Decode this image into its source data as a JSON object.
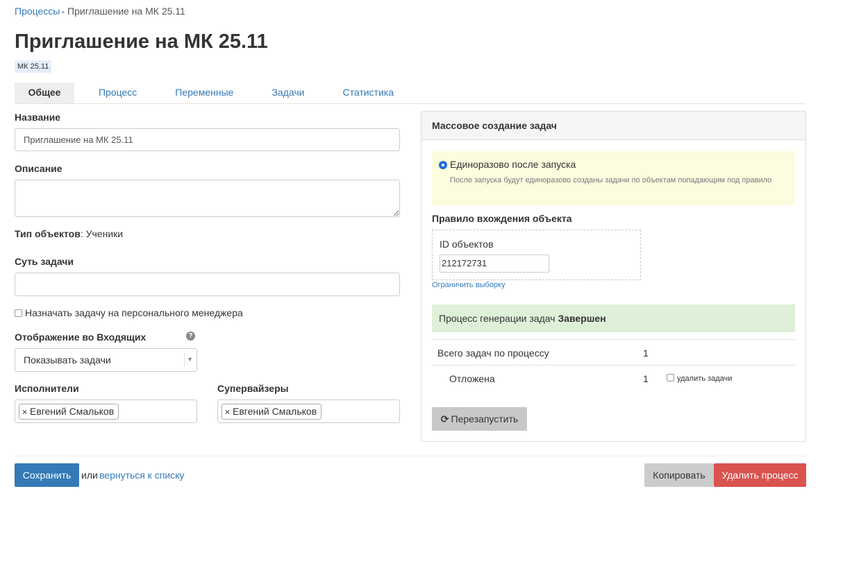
{
  "breadcrumb": {
    "root": "Процессы",
    "separator": "-",
    "current": "Приглашение на МК 25.11"
  },
  "page": {
    "title": "Приглашение на МК 25.11",
    "badge": "МК 25.11"
  },
  "tabs": [
    {
      "label": "Общее",
      "active": true
    },
    {
      "label": "Процесс"
    },
    {
      "label": "Переменные"
    },
    {
      "label": "Задачи"
    },
    {
      "label": "Статистика"
    }
  ],
  "form": {
    "name_label": "Название",
    "name_value": "Приглашение на МК 25.11",
    "description_label": "Описание",
    "description_value": "",
    "object_type_label": "Тип объектов",
    "object_type_value": ": Ученики",
    "task_essence_label": "Суть задачи",
    "task_essence_value": "",
    "assign_manager_label": "Назначать задачу на персонального менеджера",
    "inbox_display_label": "Отображение во Входящих",
    "inbox_display_value": "Показывать задачи",
    "help_icon": "?",
    "executors_label": "Исполнители",
    "executor": "Евгений Смальков",
    "supervisors_label": "Супервайзеры",
    "supervisor": "Евгений Смальков",
    "chip_remove": "×"
  },
  "panel": {
    "title": "Массовое создание задач",
    "radio_label": "Единоразово после запуска",
    "radio_hint": "После запуска будут единоразово созданы задачи по объектам попадающим под правило",
    "rule_label": "Правило вхождения объекта",
    "ids_label": "ID объектов",
    "ids_value": "212172731",
    "limit_link": "Ограничить выборку",
    "status_prefix": "Процесс генерации задач",
    "status_value": "Завершен",
    "total_label": "Всего задач по процессу",
    "total_value": "1",
    "postponed_label": "Отложена",
    "postponed_value": "1",
    "delete_tasks_label": "удалить задачи",
    "restart_icon": "⟳",
    "restart_label": "Перезапустить"
  },
  "footer": {
    "save_label": "Сохранить",
    "or_text": "или",
    "back_link": "вернуться к списку",
    "copy_label": "Копировать",
    "delete_label": "Удалить процесс"
  },
  "colors": {
    "primary": "#337ab7",
    "danger": "#d9534f",
    "success_bg": "#dff0d8",
    "notice_bg": "#fcfcdf"
  }
}
